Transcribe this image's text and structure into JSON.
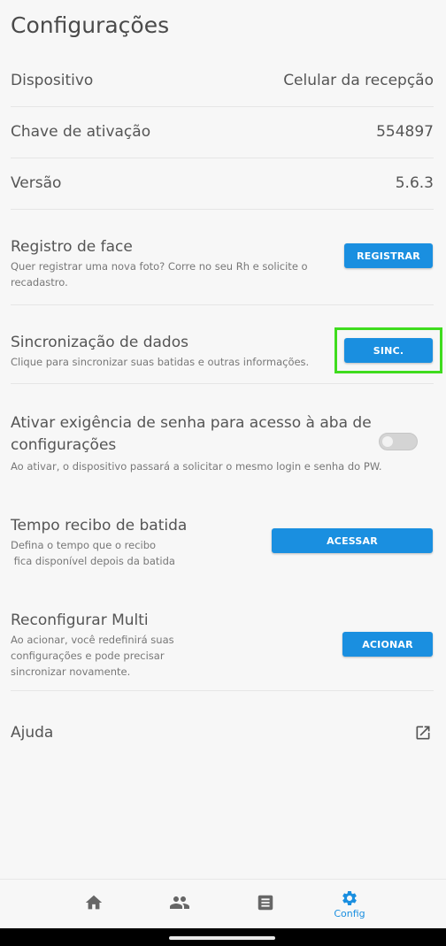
{
  "page": {
    "title": "Configurações"
  },
  "info": {
    "device_label": "Dispositivo",
    "device_value": "Celular da recepção",
    "key_label": "Chave de ativação",
    "key_value": "554897",
    "version_label": "Versão",
    "version_value": "5.6.3"
  },
  "face": {
    "title": "Registro de face",
    "desc_line1": "Quer registrar uma nova foto? Corre no seu Rh e solicite o",
    "desc_line2": "recadastro.",
    "button": "REGISTRAR"
  },
  "sync": {
    "title": "Sincronização de dados",
    "desc": "Clique para sincronizar suas batidas e outras informações.",
    "button": "SINC."
  },
  "password": {
    "title_line1": "Ativar exigência de senha para acesso à aba de",
    "title_line2": "configurações",
    "desc": "Ao ativar, o dispositivo passará a solicitar o mesmo login e senha do PW.",
    "enabled": false
  },
  "receipt": {
    "title": "Tempo recibo de batida",
    "desc_line1": "Defina o tempo que o recibo",
    "desc_line2": " fica disponível depois da batida",
    "button": "ACESSAR"
  },
  "reconfig": {
    "title": "Reconfigurar Multi",
    "desc_line1": "Ao acionar, você redefinirá suas",
    "desc_line2": "configurações e pode precisar",
    "desc_line3": "sincronizar novamente.",
    "button": "ACIONAR"
  },
  "help": {
    "label": "Ajuda"
  },
  "nav": {
    "config_label": "Config",
    "active_color": "#1a8fe0",
    "inactive_color": "#666666"
  },
  "colors": {
    "accent": "#1a8fe0",
    "highlight": "#3fdc1e"
  }
}
